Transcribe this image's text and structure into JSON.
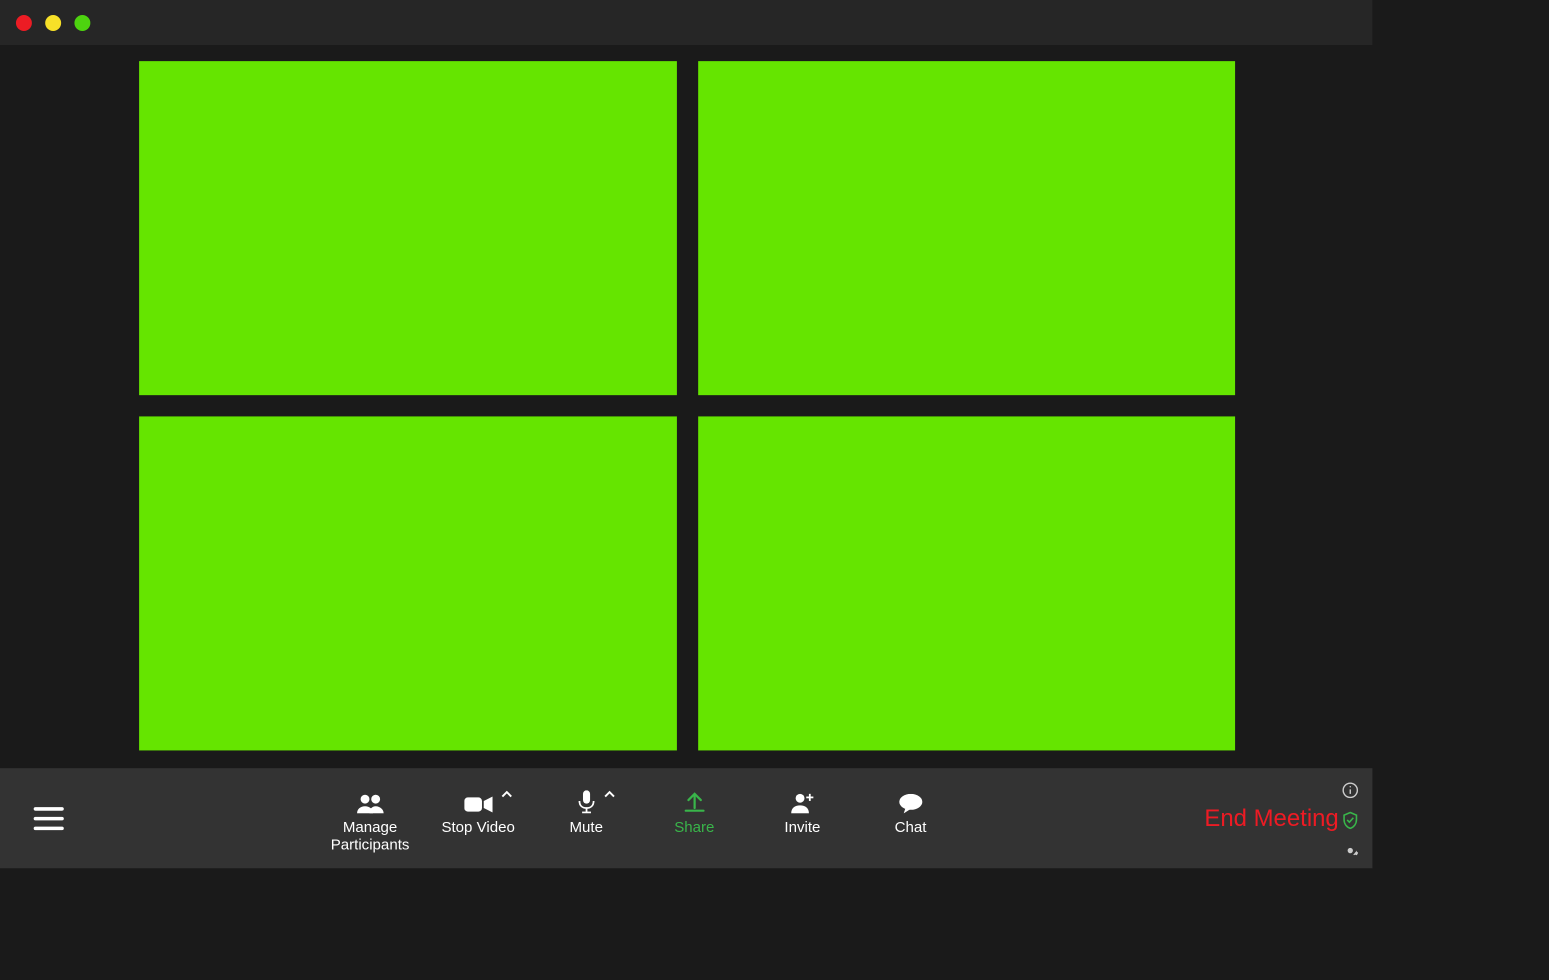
{
  "colors": {
    "video_tile": "#65e500",
    "accent": "#39b54a",
    "end_meeting": "#ed1b24",
    "titlebar": "#262626",
    "toolbar": "#333333",
    "background": "#1a1a1a"
  },
  "window": {
    "traffic_lights": [
      "close",
      "minimize",
      "zoom"
    ]
  },
  "video": {
    "tiles": [
      1,
      2,
      3,
      4
    ]
  },
  "toolbar": {
    "menu_icon": "hamburger-icon",
    "controls": {
      "manage_participants": {
        "label_line1": "Manage",
        "label_line2": "Participants",
        "icon": "participants-icon"
      },
      "stop_video": {
        "label": "Stop Video",
        "icon": "video-camera-icon",
        "has_caret": true
      },
      "mute": {
        "label": "Mute",
        "icon": "microphone-icon",
        "has_caret": true
      },
      "share": {
        "label": "Share",
        "icon": "share-up-arrow-icon",
        "accent": true
      },
      "invite": {
        "label": "Invite",
        "icon": "invite-person-plus-icon"
      },
      "chat": {
        "label": "Chat",
        "icon": "chat-bubble-icon"
      }
    },
    "end_meeting_label": "End Meeting"
  },
  "side_icons": {
    "info": "info-icon",
    "shield": "shield-check-icon",
    "settings": "gear-icon"
  }
}
